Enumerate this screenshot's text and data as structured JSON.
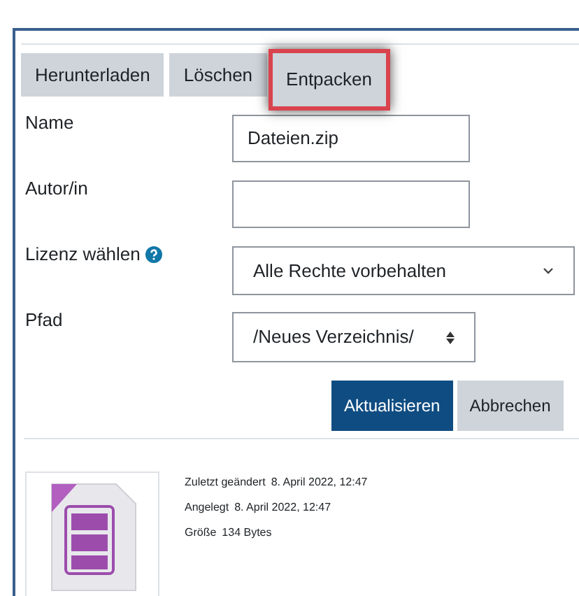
{
  "toolbar": [
    {
      "label": "Herunterladen",
      "highlighted": false
    },
    {
      "label": "Löschen",
      "highlighted": false
    },
    {
      "label": "Entpacken",
      "highlighted": true
    }
  ],
  "fields": [
    {
      "kind": "text",
      "label": "Name",
      "value": "Dateien.zip"
    },
    {
      "kind": "text",
      "label": "Autor/in"
    },
    {
      "kind": "select",
      "label": "Lizenz wählen",
      "help": true,
      "value": "Alle Rechte vorbehalten"
    },
    {
      "kind": "path",
      "label": "Pfad",
      "value": "/Neues Verzeichnis/"
    }
  ],
  "actions": [
    {
      "label": "Aktualisieren",
      "primary": true
    },
    {
      "label": "Abbrechen",
      "primary": false
    }
  ],
  "info": [
    {
      "label": "Zuletzt geändert",
      "value": "8. April 2022, 12:47"
    },
    {
      "label": "Angelegt",
      "value": "8. April 2022, 12:47"
    },
    {
      "label": "Größe",
      "value": "134 Bytes"
    }
  ]
}
